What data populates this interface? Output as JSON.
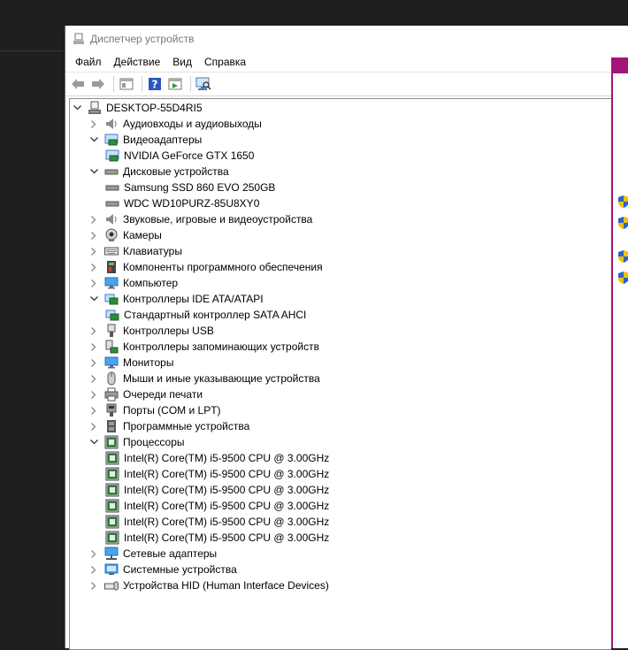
{
  "window": {
    "title": "Диспетчер устройств"
  },
  "menu": [
    "Файл",
    "Действие",
    "Вид",
    "Справка"
  ],
  "toolbar": [
    "back",
    "forward",
    "properties",
    "help",
    "update-driver",
    "scan-hardware"
  ],
  "colors": {
    "accent_panel": "#a4157a",
    "border": "#8d8d8d"
  },
  "tree": [
    {
      "label": "DESKTOP-55D4RI5",
      "level": 0,
      "expander": "open",
      "icon": "computer-icon"
    },
    {
      "label": "Аудиовходы и аудиовыходы",
      "level": 1,
      "expander": "closed",
      "icon": "speaker-icon"
    },
    {
      "label": "Видеоадаптеры",
      "level": 1,
      "expander": "open",
      "icon": "display-adapter-icon"
    },
    {
      "label": "NVIDIA GeForce GTX 1650",
      "level": 2,
      "expander": "none",
      "icon": "display-adapter-icon"
    },
    {
      "label": "Дисковые устройства",
      "level": 1,
      "expander": "open",
      "icon": "disk-drive-icon"
    },
    {
      "label": "Samsung SSD 860 EVO 250GB",
      "level": 2,
      "expander": "none",
      "icon": "disk-drive-icon"
    },
    {
      "label": "WDC WD10PURZ-85U8XY0",
      "level": 2,
      "expander": "none",
      "icon": "disk-drive-icon"
    },
    {
      "label": "Звуковые, игровые и видеоустройства",
      "level": 1,
      "expander": "closed",
      "icon": "speaker-icon"
    },
    {
      "label": "Камеры",
      "level": 1,
      "expander": "closed",
      "icon": "camera-icon"
    },
    {
      "label": "Клавиатуры",
      "level": 1,
      "expander": "closed",
      "icon": "keyboard-icon"
    },
    {
      "label": "Компоненты программного обеспечения",
      "level": 1,
      "expander": "closed",
      "icon": "software-component-icon"
    },
    {
      "label": "Компьютер",
      "level": 1,
      "expander": "closed",
      "icon": "monitor-icon"
    },
    {
      "label": "Контроллеры IDE ATA/ATAPI",
      "level": 1,
      "expander": "open",
      "icon": "ide-controller-icon"
    },
    {
      "label": "Стандартный контроллер SATA AHCI",
      "level": 2,
      "expander": "none",
      "icon": "ide-controller-icon"
    },
    {
      "label": "Контроллеры USB",
      "level": 1,
      "expander": "closed",
      "icon": "usb-icon"
    },
    {
      "label": "Контроллеры запоминающих устройств",
      "level": 1,
      "expander": "closed",
      "icon": "storage-controller-icon"
    },
    {
      "label": "Мониторы",
      "level": 1,
      "expander": "closed",
      "icon": "monitor-icon"
    },
    {
      "label": "Мыши и иные указывающие устройства",
      "level": 1,
      "expander": "closed",
      "icon": "mouse-icon"
    },
    {
      "label": "Очереди печати",
      "level": 1,
      "expander": "closed",
      "icon": "printer-icon"
    },
    {
      "label": "Порты (COM и LPT)",
      "level": 1,
      "expander": "closed",
      "icon": "port-icon"
    },
    {
      "label": "Программные устройства",
      "level": 1,
      "expander": "closed",
      "icon": "software-device-icon"
    },
    {
      "label": "Процессоры",
      "level": 1,
      "expander": "open",
      "icon": "cpu-icon"
    },
    {
      "label": "Intel(R) Core(TM) i5-9500 CPU @ 3.00GHz",
      "level": 2,
      "expander": "none",
      "icon": "cpu-icon"
    },
    {
      "label": "Intel(R) Core(TM) i5-9500 CPU @ 3.00GHz",
      "level": 2,
      "expander": "none",
      "icon": "cpu-icon"
    },
    {
      "label": "Intel(R) Core(TM) i5-9500 CPU @ 3.00GHz",
      "level": 2,
      "expander": "none",
      "icon": "cpu-icon"
    },
    {
      "label": "Intel(R) Core(TM) i5-9500 CPU @ 3.00GHz",
      "level": 2,
      "expander": "none",
      "icon": "cpu-icon"
    },
    {
      "label": "Intel(R) Core(TM) i5-9500 CPU @ 3.00GHz",
      "level": 2,
      "expander": "none",
      "icon": "cpu-icon"
    },
    {
      "label": "Intel(R) Core(TM) i5-9500 CPU @ 3.00GHz",
      "level": 2,
      "expander": "none",
      "icon": "cpu-icon"
    },
    {
      "label": "Сетевые адаптеры",
      "level": 1,
      "expander": "closed",
      "icon": "network-adapter-icon"
    },
    {
      "label": "Системные устройства",
      "level": 1,
      "expander": "closed",
      "icon": "system-device-icon"
    },
    {
      "label": "Устройства HID (Human Interface Devices)",
      "level": 1,
      "expander": "closed",
      "icon": "hid-icon"
    }
  ]
}
